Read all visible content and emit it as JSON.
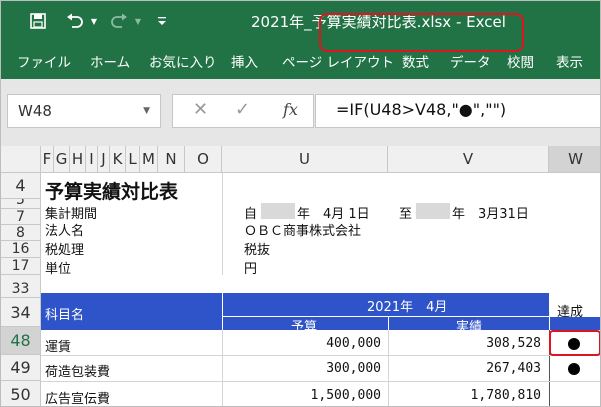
{
  "titlebar": {
    "title": "2021年_予算実績対比表.xlsx - Excel",
    "icons": [
      "save-icon",
      "undo-icon",
      "redo-icon",
      "customize-qat-icon"
    ]
  },
  "ribbon": {
    "tabs": [
      "ファイル",
      "ホーム",
      "お気に入り",
      "挿入",
      "ページ レイアウト",
      "数式",
      "データ",
      "校閲",
      "表示"
    ]
  },
  "formula_bar": {
    "name_box": "W48",
    "cancel_glyph": "✕",
    "enter_glyph": "✓",
    "fx_label": "fx",
    "formula": "=IF(U48>V48,\"●\",\"\")"
  },
  "columns": {
    "left_letters": [
      "F",
      "G",
      "H",
      "I",
      "J",
      "K",
      "L",
      "M",
      "N",
      "O"
    ],
    "u": "U",
    "v": "V",
    "w": "W"
  },
  "rows": {
    "r4": "4",
    "r5": "5",
    "r7": "7",
    "r8": "8",
    "r16": "16",
    "r17": "17",
    "r33": "33",
    "r34": "34",
    "r48": "48",
    "r49": "49",
    "r50": "50"
  },
  "report": {
    "title": "予算実績対比表",
    "period_label": "集計期間",
    "period_from_prefix": "自",
    "period_from": "年　4月 1日",
    "period_to_prefix": "至",
    "period_to": "年　3月31日",
    "company_label": "法人名",
    "company": "ＯＢＣ商事株式会社",
    "tax_label": "税処理",
    "tax": "税抜",
    "unit_label": "単位",
    "unit": "円"
  },
  "table": {
    "account_header": "科目名",
    "period_header": "2021年　4月",
    "budget_header": "予算",
    "actual_header": "実績",
    "achieved_header": "達成",
    "rows": [
      {
        "account": "運賃",
        "budget": "400,000",
        "actual": "308,528",
        "mark": "●"
      },
      {
        "account": "荷造包装費",
        "budget": "300,000",
        "actual": "267,403",
        "mark": "●"
      },
      {
        "account": "広告宣伝費",
        "budget": "1,500,000",
        "actual": "1,780,810",
        "mark": ""
      }
    ]
  }
}
